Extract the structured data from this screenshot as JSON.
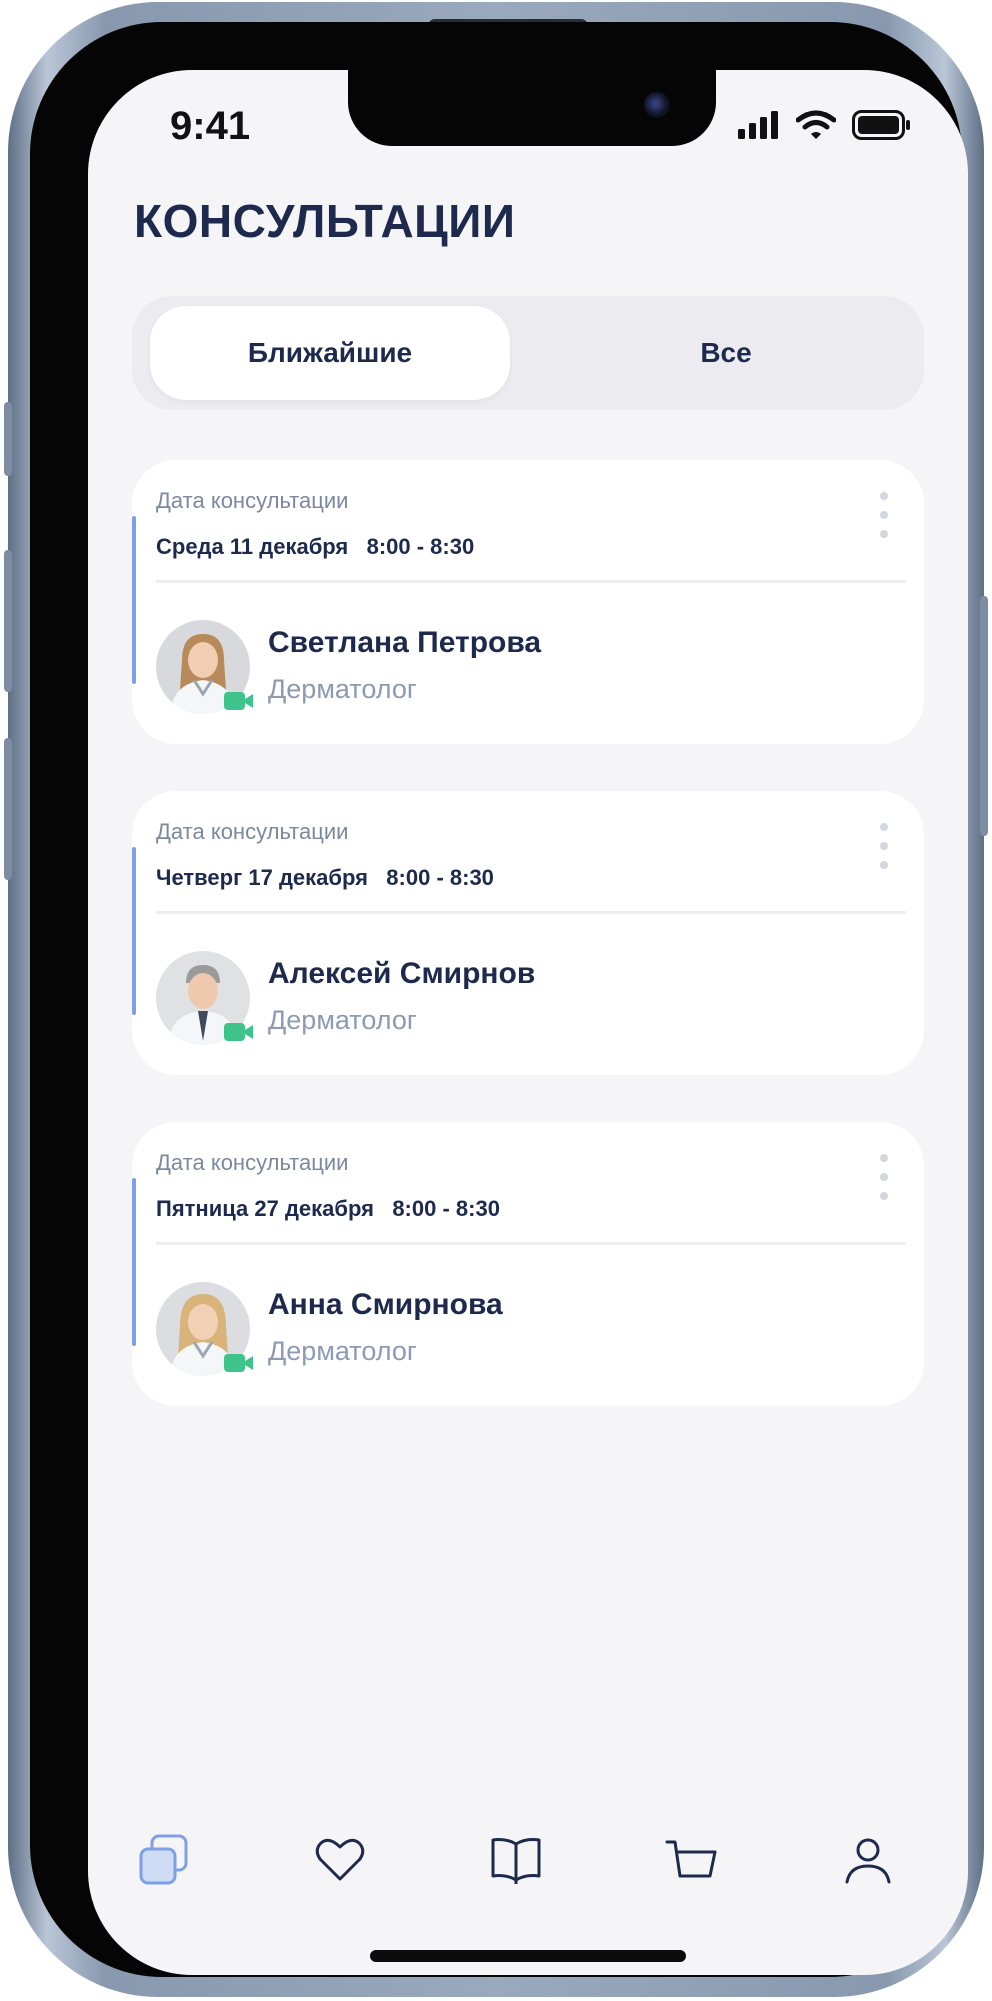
{
  "status_bar": {
    "time": "9:41"
  },
  "header": {
    "title": "КОНСУЛЬТАЦИИ"
  },
  "tabs": {
    "upcoming": "Ближайшие",
    "all": "Все"
  },
  "consultations": [
    {
      "label": "Дата консультации",
      "date": "Среда 11 декабря   8:00 - 8:30",
      "doctor": "Светлана Петрова",
      "specialty": "Дерматолог"
    },
    {
      "label": "Дата консультации",
      "date": "Четверг 17 декабря   8:00 - 8:30",
      "doctor": "Алексей Смирнов",
      "specialty": "Дерматолог"
    },
    {
      "label": "Дата консультации",
      "date": "Пятница 27 декабря   8:00 - 8:30",
      "doctor": "Анна Смирнова",
      "specialty": "Дерматолог"
    }
  ],
  "colors": {
    "title": "#1d2a4d",
    "accent": "#7ea1e6",
    "muted": "#8e9ab3",
    "video_badge": "#3ec48a",
    "active_tab_icon": "#7ea1e6"
  },
  "nav_icons": [
    "consultations-icon",
    "heart-icon",
    "book-icon",
    "cart-icon",
    "profile-icon"
  ]
}
